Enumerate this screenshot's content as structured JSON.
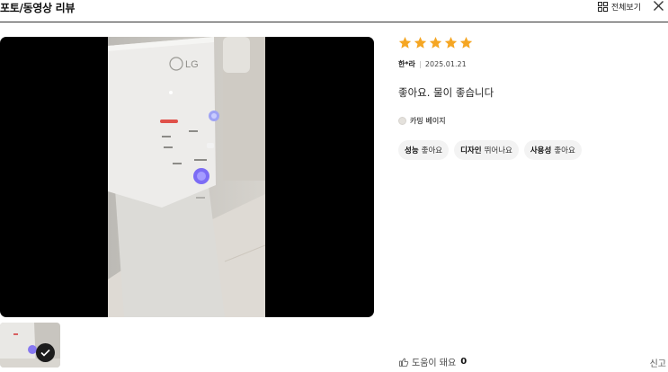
{
  "header": {
    "title": "포토/동영상 리뷰",
    "view_all_label": "전체보기",
    "grid_icon": "grid-icon",
    "close_icon": "close-icon"
  },
  "media": {
    "brand_text": "LG",
    "thumbnail_selected_icon": "check-icon"
  },
  "review": {
    "rating": 5,
    "rating_max": 5,
    "star_color": "#f5a623",
    "author": "한*라",
    "date": "2025.01.21",
    "text": "좋아요. 물이 좋습니다",
    "option_label": "카밍 베이지",
    "option_color": "#e4e1dc",
    "tags": [
      {
        "key": "성능",
        "value": "좋아요"
      },
      {
        "key": "디자인",
        "value": "뛰어나요"
      },
      {
        "key": "사용성",
        "value": "좋아요"
      }
    ],
    "helpful_label": "도움이 돼요",
    "helpful_count": "0",
    "report_label": "신고"
  }
}
